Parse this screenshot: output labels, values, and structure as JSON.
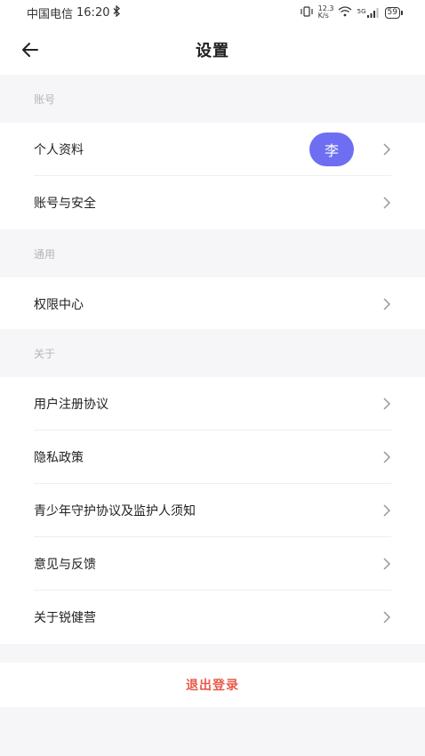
{
  "status_bar": {
    "carrier": "中国电信",
    "time": "16:20",
    "network_speed": "12.3\nK/s",
    "signal_label": "5G",
    "battery": "59"
  },
  "header": {
    "title": "设置"
  },
  "sections": {
    "account": {
      "label": "账号",
      "items": [
        {
          "label": "个人资料",
          "avatar_text": "李"
        },
        {
          "label": "账号与安全"
        }
      ]
    },
    "general": {
      "label": "通用",
      "items": [
        {
          "label": "权限中心"
        }
      ]
    },
    "about": {
      "label": "关于",
      "items": [
        {
          "label": "用户注册协议"
        },
        {
          "label": "隐私政策"
        },
        {
          "label": "青少年守护协议及监护人须知"
        },
        {
          "label": "意见与反馈"
        },
        {
          "label": "关于锐健营"
        }
      ]
    }
  },
  "logout": {
    "label": "退出登录"
  },
  "colors": {
    "accent_avatar": "#6e6ef2",
    "logout_text": "#e85b4a",
    "background": "#f6f6f8"
  }
}
